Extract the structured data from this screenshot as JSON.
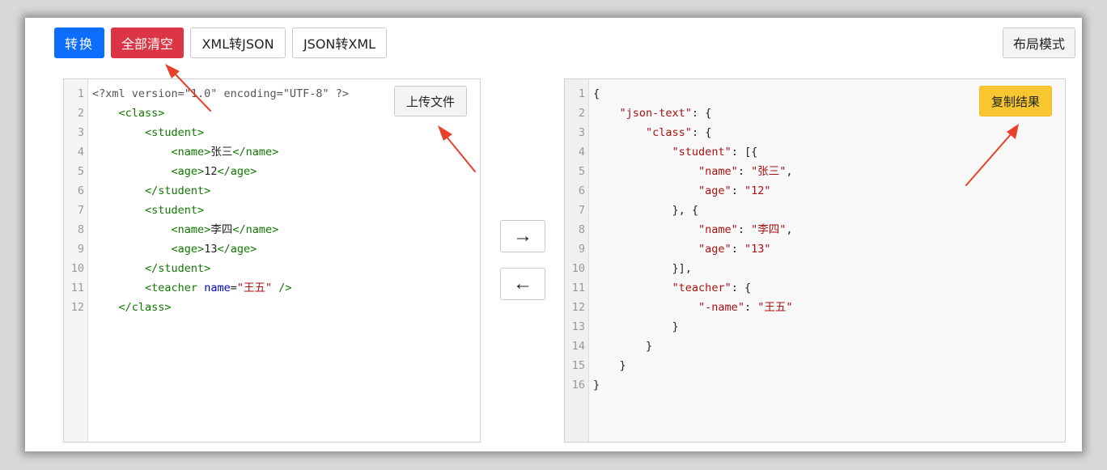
{
  "toolbar": {
    "convert_label": "转换",
    "clear_all_label": "全部清空",
    "xml_to_json_label": "XML转JSON",
    "json_to_xml_label": "JSON转XML",
    "layout_mode_label": "布局模式"
  },
  "left_editor": {
    "upload_label": "上传文件",
    "lines": [
      {
        "n": "1",
        "parts": [
          {
            "t": "<?xml version=\"1.0\" encoding=\"UTF-8\" ?>",
            "c": "meta"
          }
        ]
      },
      {
        "n": "2",
        "parts": [
          {
            "t": "    "
          },
          {
            "t": "<class>",
            "c": "tag"
          }
        ]
      },
      {
        "n": "3",
        "parts": [
          {
            "t": "        "
          },
          {
            "t": "<student>",
            "c": "tag"
          }
        ]
      },
      {
        "n": "4",
        "parts": [
          {
            "t": "            "
          },
          {
            "t": "<name>",
            "c": "tag"
          },
          {
            "t": "张三",
            "c": "plain"
          },
          {
            "t": "</name>",
            "c": "tag"
          }
        ]
      },
      {
        "n": "5",
        "parts": [
          {
            "t": "            "
          },
          {
            "t": "<age>",
            "c": "tag"
          },
          {
            "t": "12",
            "c": "plain"
          },
          {
            "t": "</age>",
            "c": "tag"
          }
        ]
      },
      {
        "n": "6",
        "parts": [
          {
            "t": "        "
          },
          {
            "t": "</student>",
            "c": "tag"
          }
        ]
      },
      {
        "n": "7",
        "parts": [
          {
            "t": "        "
          },
          {
            "t": "<student>",
            "c": "tag"
          }
        ]
      },
      {
        "n": "8",
        "parts": [
          {
            "t": "            "
          },
          {
            "t": "<name>",
            "c": "tag"
          },
          {
            "t": "李四",
            "c": "plain"
          },
          {
            "t": "</name>",
            "c": "tag"
          }
        ]
      },
      {
        "n": "9",
        "parts": [
          {
            "t": "            "
          },
          {
            "t": "<age>",
            "c": "tag"
          },
          {
            "t": "13",
            "c": "plain"
          },
          {
            "t": "</age>",
            "c": "tag"
          }
        ]
      },
      {
        "n": "10",
        "parts": [
          {
            "t": "        "
          },
          {
            "t": "</student>",
            "c": "tag"
          }
        ]
      },
      {
        "n": "11",
        "parts": [
          {
            "t": "        "
          },
          {
            "t": "<teacher ",
            "c": "tag"
          },
          {
            "t": "name",
            "c": "attr"
          },
          {
            "t": "=",
            "c": "plain"
          },
          {
            "t": "\"王五\"",
            "c": "str"
          },
          {
            "t": " />",
            "c": "tag"
          }
        ]
      },
      {
        "n": "12",
        "parts": [
          {
            "t": "    "
          },
          {
            "t": "</class>",
            "c": "tag"
          }
        ]
      }
    ]
  },
  "convert_buttons": {
    "to_right_symbol": "→",
    "to_left_symbol": "←"
  },
  "right_editor": {
    "copy_label": "复制结果",
    "lines": [
      {
        "n": "1",
        "parts": [
          {
            "t": "{",
            "c": "plain"
          }
        ]
      },
      {
        "n": "2",
        "parts": [
          {
            "t": "    "
          },
          {
            "t": "\"json-text\"",
            "c": "str"
          },
          {
            "t": ": {",
            "c": "plain"
          }
        ]
      },
      {
        "n": "3",
        "parts": [
          {
            "t": "        "
          },
          {
            "t": "\"class\"",
            "c": "str"
          },
          {
            "t": ": {",
            "c": "plain"
          }
        ]
      },
      {
        "n": "4",
        "parts": [
          {
            "t": "            "
          },
          {
            "t": "\"student\"",
            "c": "str"
          },
          {
            "t": ": [{",
            "c": "plain"
          }
        ]
      },
      {
        "n": "5",
        "parts": [
          {
            "t": "                "
          },
          {
            "t": "\"name\"",
            "c": "str"
          },
          {
            "t": ": ",
            "c": "plain"
          },
          {
            "t": "\"张三\"",
            "c": "str"
          },
          {
            "t": ",",
            "c": "plain"
          }
        ]
      },
      {
        "n": "6",
        "parts": [
          {
            "t": "                "
          },
          {
            "t": "\"age\"",
            "c": "str"
          },
          {
            "t": ": ",
            "c": "plain"
          },
          {
            "t": "\"12\"",
            "c": "str"
          }
        ]
      },
      {
        "n": "7",
        "parts": [
          {
            "t": "            "
          },
          {
            "t": "}, {",
            "c": "plain"
          }
        ]
      },
      {
        "n": "8",
        "parts": [
          {
            "t": "                "
          },
          {
            "t": "\"name\"",
            "c": "str"
          },
          {
            "t": ": ",
            "c": "plain"
          },
          {
            "t": "\"李四\"",
            "c": "str"
          },
          {
            "t": ",",
            "c": "plain"
          }
        ]
      },
      {
        "n": "9",
        "parts": [
          {
            "t": "                "
          },
          {
            "t": "\"age\"",
            "c": "str"
          },
          {
            "t": ": ",
            "c": "plain"
          },
          {
            "t": "\"13\"",
            "c": "str"
          }
        ]
      },
      {
        "n": "10",
        "parts": [
          {
            "t": "            "
          },
          {
            "t": "}],",
            "c": "plain"
          }
        ]
      },
      {
        "n": "11",
        "parts": [
          {
            "t": "            "
          },
          {
            "t": "\"teacher\"",
            "c": "str"
          },
          {
            "t": ": {",
            "c": "plain"
          }
        ]
      },
      {
        "n": "12",
        "parts": [
          {
            "t": "                "
          },
          {
            "t": "\"-name\"",
            "c": "str"
          },
          {
            "t": ": ",
            "c": "plain"
          },
          {
            "t": "\"王五\"",
            "c": "str"
          }
        ]
      },
      {
        "n": "13",
        "parts": [
          {
            "t": "            "
          },
          {
            "t": "}",
            "c": "plain"
          }
        ]
      },
      {
        "n": "14",
        "parts": [
          {
            "t": "        "
          },
          {
            "t": "}",
            "c": "plain"
          }
        ]
      },
      {
        "n": "15",
        "parts": [
          {
            "t": "    "
          },
          {
            "t": "}",
            "c": "plain"
          }
        ]
      },
      {
        "n": "16",
        "parts": [
          {
            "t": "}",
            "c": "plain"
          }
        ]
      }
    ]
  },
  "colors": {
    "primary": "#0d6efd",
    "danger": "#dc3545",
    "warning": "#f7c631",
    "annotation_arrow": "#e8402a"
  }
}
